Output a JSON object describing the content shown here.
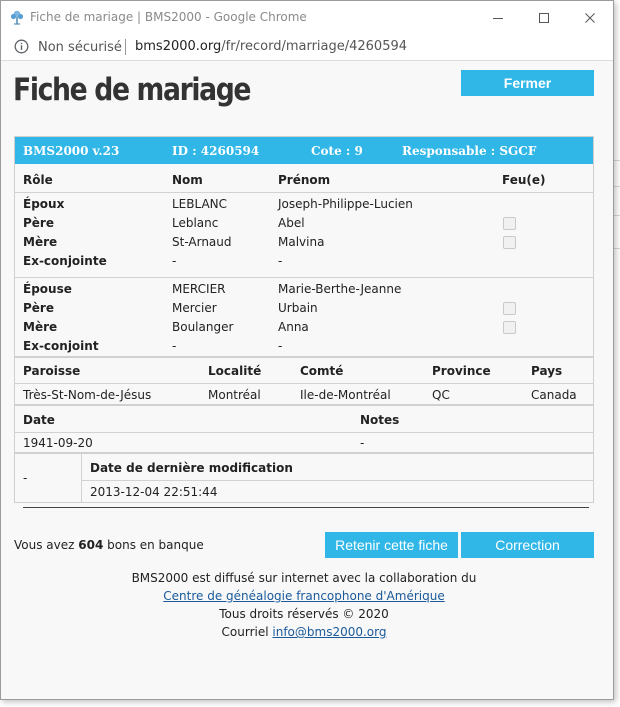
{
  "window": {
    "title": "Fiche de mariage | BMS2000 - Google Chrome",
    "security_label": "Non sécurisé",
    "url_host": "bms2000.org",
    "url_path": "/fr/record/marriage/4260594"
  },
  "page": {
    "title": "Fiche de mariage",
    "close_label": "Fermer"
  },
  "record_header": {
    "version": "BMS2000 v.23",
    "id": "ID : 4260594",
    "cote": "Cote : 9",
    "responsable": "Responsable : SGCF"
  },
  "people_columns": {
    "role": "Rôle",
    "nom": "Nom",
    "prenom": "Prénom",
    "feu": "Feu(e)"
  },
  "epoux": [
    {
      "role": "Époux",
      "nom": "LEBLANC",
      "prenom": "Joseph-Philippe-Lucien"
    },
    {
      "role": "Père",
      "nom": "Leblanc",
      "prenom": "Abel"
    },
    {
      "role": "Mère",
      "nom": "St-Arnaud",
      "prenom": "Malvina"
    },
    {
      "role": "Ex-conjointe",
      "nom": "-",
      "prenom": "-"
    }
  ],
  "epouse": [
    {
      "role": "Épouse",
      "nom": "MERCIER",
      "prenom": "Marie-Berthe-Jeanne"
    },
    {
      "role": "Père",
      "nom": "Mercier",
      "prenom": "Urbain"
    },
    {
      "role": "Mère",
      "nom": "Boulanger",
      "prenom": "Anna"
    },
    {
      "role": "Ex-conjoint",
      "nom": "-",
      "prenom": "-"
    }
  ],
  "place_columns": {
    "paroisse": "Paroisse",
    "localite": "Localité",
    "comte": "Comté",
    "province": "Province",
    "pays": "Pays"
  },
  "place": {
    "paroisse": "Très-St-Nom-de-Jésus",
    "localite": "Montréal",
    "comte": "Ile-de-Montréal",
    "province": "QC",
    "pays": "Canada"
  },
  "date_columns": {
    "date": "Date",
    "notes": "Notes"
  },
  "date_row": {
    "date": "1941-09-20",
    "notes": "-"
  },
  "modification": {
    "left_value": "-",
    "label": "Date de dernière modification",
    "value": "2013-12-04 22:51:44"
  },
  "bank": {
    "prefix": "Vous avez ",
    "count": "604",
    "suffix": " bons en banque"
  },
  "actions": {
    "keep_label": "Retenir cette fiche",
    "correction_label": "Correction"
  },
  "footer": {
    "line1": "BMS2000 est diffusé sur internet avec la collaboration du",
    "link": "Centre de généalogie francophone d'Amérique",
    "line3": "Tous droits réservés © 2020",
    "mail_prefix": "Courriel ",
    "mail": "info@bms2000.org"
  },
  "colors": {
    "accent": "#30b7e7",
    "link": "#1a5a9a"
  }
}
